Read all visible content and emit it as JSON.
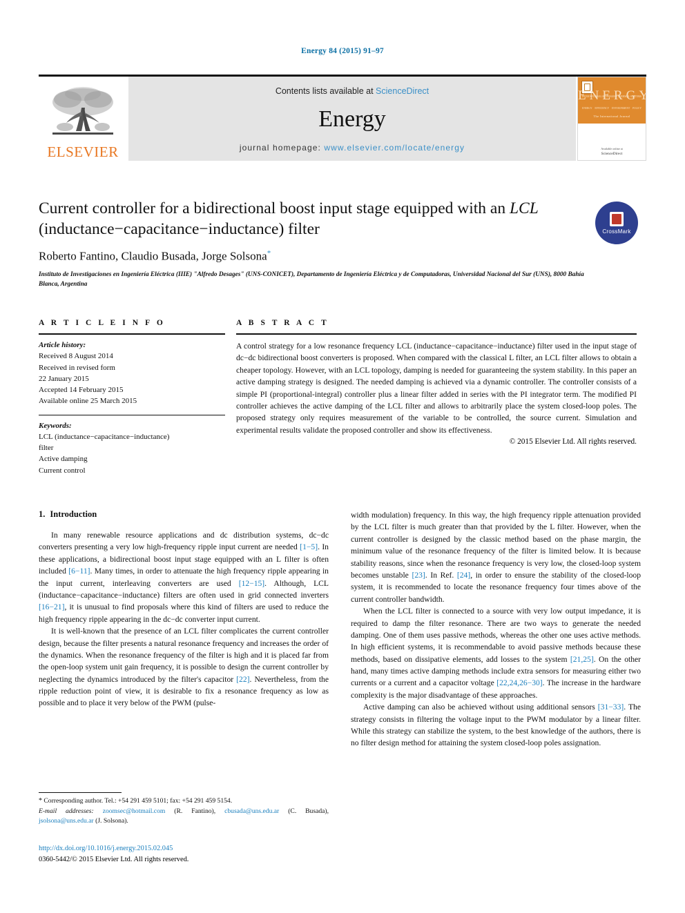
{
  "running_head": "Energy 84 (2015) 91–97",
  "masthead": {
    "publisher_name": "ELSEVIER",
    "contents_prefix": "Contents lists available at",
    "contents_link": "ScienceDirect",
    "journal_name": "Energy",
    "homepage_prefix": "journal homepage:",
    "homepage_url": "www.elsevier.com/locate/energy",
    "cover": {
      "title": "ENERGY",
      "subtitle": "The International Journal",
      "tiny_row_top": [
        "INTERNATIONAL",
        "RENEWABLE",
        "THERMAL",
        "SYSTEMS"
      ],
      "tiny_row_bottom": [
        "ENERGY",
        "EFFICIENCY",
        "ENVIRONMENT",
        "POLICY"
      ],
      "bottom_text": "Available online at",
      "bottom_brand": "ScienceDirect"
    }
  },
  "article": {
    "title_line1": "Current controller for a bidirectional boost input stage equipped with",
    "title_line2_pre": "an ",
    "title_italic": "LCL",
    "title_line2_post": " (inductance−capacitance−inductance) filter",
    "authors": "Roberto Fantino, Claudio Busada, Jorge Solsona",
    "author_marker": "*",
    "affiliation": "Instituto de Investigaciones en Ingeniería Eléctrica (IIIE) \"Alfredo Desages\" (UNS-CONICET), Departamento de Ingeniería Eléctrica y de Computadoras, Universidad Nacional del Sur (UNS), 8000 Bahía Blanca, Argentina",
    "crossmark_label": "CrossMark"
  },
  "article_info": {
    "heading": "A R T I C L E   I N F O",
    "history_label": "Article history:",
    "history": [
      "Received 8 August 2014",
      "Received in revised form",
      "22 January 2015",
      "Accepted 14 February 2015",
      "Available online 25 March 2015"
    ],
    "keywords_label": "Keywords:",
    "keywords": [
      "LCL (inductance−capacitance−inductance)",
      "filter",
      "Active damping",
      "Current control"
    ]
  },
  "abstract": {
    "heading": "A B S T R A C T",
    "text": "A control strategy for a low resonance frequency LCL (inductance−capacitance−inductance) filter used in the input stage of dc−dc bidirectional boost converters is proposed. When compared with the classical L filter, an LCL filter allows to obtain a cheaper topology. However, with an LCL topology, damping is needed for guaranteeing the system stability. In this paper an active damping strategy is designed. The needed damping is achieved via a dynamic controller. The controller consists of a simple PI (proportional-integral) controller plus a linear filter added in series with the PI integrator term. The modified PI controller achieves the active damping of the LCL filter and allows to arbitrarily place the system closed-loop poles. The proposed strategy only requires measurement of the variable to be controlled, the source current. Simulation and experimental results validate the proposed controller and show its effectiveness.",
    "copyright": "© 2015 Elsevier Ltd. All rights reserved."
  },
  "sections": {
    "intro_number": "1.",
    "intro_title": "Introduction",
    "left_paragraphs": [
      "In many renewable resource applications and dc distribution systems, dc−dc converters presenting a very low high-frequency ripple input current are needed [1−5]. In these applications, a bidirectional boost input stage equipped with an L filter is often included [6−11]. Many times, in order to attenuate the high frequency ripple appearing in the input current, interleaving converters are used [12−15]. Although, LCL (inductance−capacitance−inductance) filters are often used in grid connected inverters [16−21], it is unusual to find proposals where this kind of filters are used to reduce the high frequency ripple appearing in the dc−dc converter input current.",
      "It is well-known that the presence of an LCL filter complicates the current controller design, because the filter presents a natural resonance frequency and increases the order of the dynamics. When the resonance frequency of the filter is high and it is placed far from the open-loop system unit gain frequency, it is possible to design the current controller by neglecting the dynamics introduced by the filter's capacitor [22]. Nevertheless, from the ripple reduction point of view, it is desirable to fix a resonance frequency as low as possible and to place it very below of the PWM (pulse-"
    ],
    "right_paragraphs": [
      "width modulation) frequency. In this way, the high frequency ripple attenuation provided by the LCL filter is much greater than that provided by the L filter. However, when the current controller is designed by the classic method based on the phase margin, the minimum value of the resonance frequency of the filter is limited below. It is because stability reasons, since when the resonance frequency is very low, the closed-loop system becomes unstable [23]. In Ref. [24], in order to ensure the stability of the closed-loop system, it is recommended to locate the resonance frequency four times above of the current controller bandwidth.",
      "When the LCL filter is connected to a source with very low output impedance, it is required to damp the filter resonance. There are two ways to generate the needed damping. One of them uses passive methods, whereas the other one uses active methods. In high efficient systems, it is recommendable to avoid passive methods because these methods, based on dissipative elements, add losses to the system [21,25]. On the other hand, many times active damping methods include extra sensors for measuring either two currents or a current and a capacitor voltage [22,24,26−30]. The increase in the hardware complexity is the major disadvantage of these approaches.",
      "Active damping can also be achieved without using additional sensors [31−33]. The strategy consists in filtering the voltage input to the PWM modulator by a linear filter. While this strategy can stabilize the system, to the best knowledge of the authors, there is no filter design method for attaining the system closed-loop poles assignation."
    ]
  },
  "footnotes": {
    "corresponding": "Corresponding author. Tel.: +54 291 459 5101; fax: +54 291 459 5154.",
    "email_label": "E-mail addresses:",
    "emails": [
      {
        "address": "zoomsec@hotmail.com",
        "owner": "(R. Fantino)"
      },
      {
        "address": "cbusada@uns.edu.ar",
        "owner": "(C. Busada)"
      },
      {
        "address": "jsolsona@uns.edu.ar",
        "owner": "(J. Solsona)."
      }
    ],
    "doi": "http://dx.doi.org/10.1016/j.energy.2015.02.045",
    "issn_line": "0360-5442/© 2015 Elsevier Ltd. All rights reserved."
  },
  "colors": {
    "link_blue": "#1b7fbd",
    "elsevier_orange": "#E87722",
    "crossmark_blue": "#2e3f8f",
    "masthead_grey": "#e4e4e4"
  }
}
